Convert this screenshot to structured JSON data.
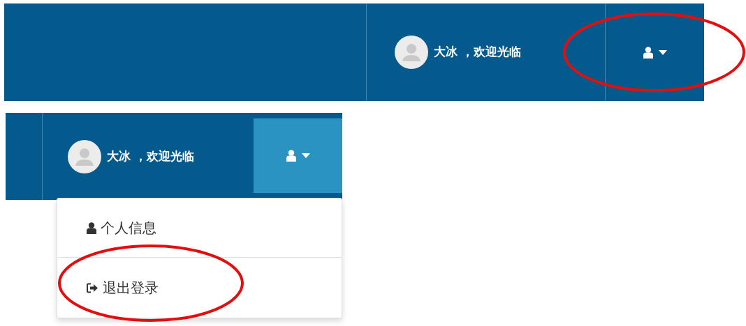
{
  "navbars": [
    {
      "user_text": "大冰 ，欢迎光临",
      "dropdown_open": false,
      "toggle_circled": true
    },
    {
      "user_text": "大冰 ，欢迎光临",
      "dropdown_open": true,
      "toggle_circled": false,
      "menu": [
        {
          "kind": "profile",
          "label": "个人信息",
          "circled": false
        },
        {
          "kind": "logout",
          "label": "退出登录",
          "circled": true
        }
      ]
    }
  ]
}
